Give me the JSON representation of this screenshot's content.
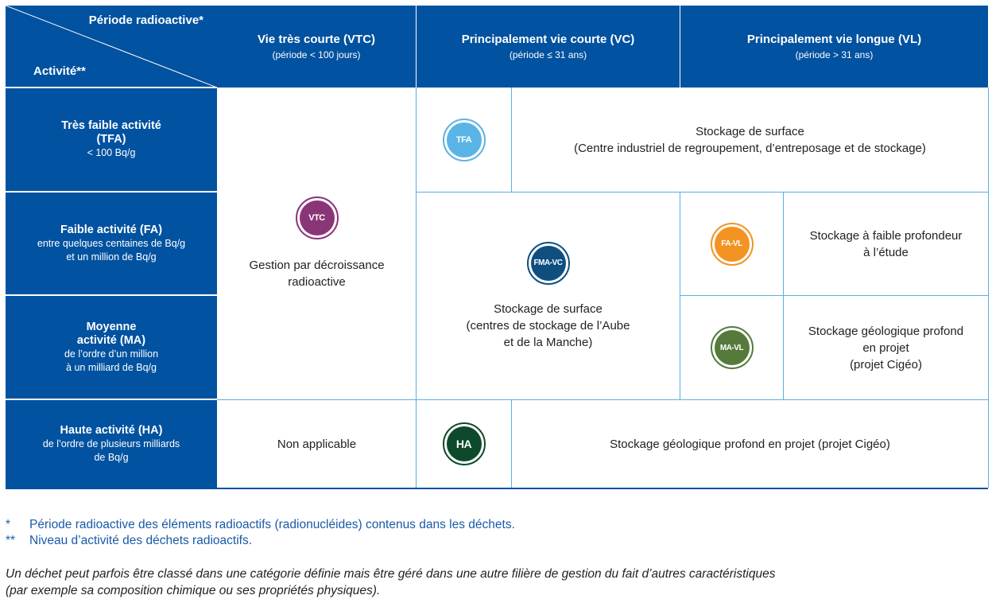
{
  "table": {
    "corner": {
      "top_label": "Période radioactive*",
      "bottom_label": "Activité**"
    },
    "columns": [
      {
        "title": "Vie très courte (VTC)",
        "subtitle": "(période < 100 jours)"
      },
      {
        "title": "Principalement vie courte (VC)",
        "subtitle": "(période ≤ 31 ans)"
      },
      {
        "title": "Principalement vie longue (VL)",
        "subtitle": "(période > 31 ans)"
      }
    ],
    "rows": [
      {
        "title": "Très faible activité\n(TFA)",
        "title_lines": [
          "Très faible activité",
          "(TFA)"
        ],
        "subtitle_lines": [
          "< 100 Bq/g"
        ]
      },
      {
        "title_lines": [
          "Faible activité (FA)"
        ],
        "subtitle_lines": [
          "entre quelques centaines de Bq/g",
          "et un million de Bq/g"
        ]
      },
      {
        "title_lines": [
          "Moyenne",
          "activité (MA)"
        ],
        "subtitle_lines": [
          "de l’ordre d’un million",
          "à un milliard de Bq/g"
        ]
      },
      {
        "title_lines": [
          "Haute activité (HA)"
        ],
        "subtitle_lines": [
          "de l’ordre de plusieurs milliards",
          "de Bq/g"
        ]
      }
    ],
    "cells": {
      "vtc": {
        "badge": "VTC",
        "badge_color": "#8a3577",
        "lines": [
          "Gestion par décroissance",
          "radioactive"
        ]
      },
      "tfa": {
        "badge": "TFA",
        "badge_color": "#5ab4e5",
        "lines": [
          "Stockage de surface",
          "(Centre industriel de regroupement, d’entreposage et de stockage)"
        ]
      },
      "fma_vc": {
        "badge": "FMA-VC",
        "badge_color": "#0e4f80",
        "lines": [
          "Stockage de surface",
          "(centres de stockage de l’Aube",
          "et de la Manche)"
        ]
      },
      "fa_vl": {
        "badge": "FA-VL",
        "badge_color": "#f39322",
        "lines": [
          "Stockage à faible profondeur",
          "à l’étude"
        ]
      },
      "ma_vl": {
        "badge": "MA-VL",
        "badge_color": "#557a3b",
        "lines": [
          "Stockage géologique profond",
          "en projet",
          "(projet Cigéo)"
        ]
      },
      "ha_vtc": {
        "lines": [
          "Non applicable"
        ]
      },
      "ha": {
        "badge": "HA",
        "badge_color": "#0d4a2b",
        "lines": [
          "Stockage géologique profond en projet (projet Cigéo)"
        ]
      }
    }
  },
  "footnotes": [
    {
      "marker": "*",
      "text": "Période radioactive des éléments radioactifs (radionucléides) contenus dans les déchets."
    },
    {
      "marker": "**",
      "text": "Niveau d’activité des déchets radioactifs."
    }
  ],
  "note_lines": [
    "Un déchet peut parfois être classé dans une catégorie définie mais être géré dans une autre filière de gestion du fait d’autres caractéristiques",
    "(par exemple sa composition chimique ou ses propriétés physiques)."
  ],
  "colors": {
    "header_blue": "#0152a0",
    "grid_line": "#5aaee0",
    "footnote_blue": "#1a5aa8"
  }
}
